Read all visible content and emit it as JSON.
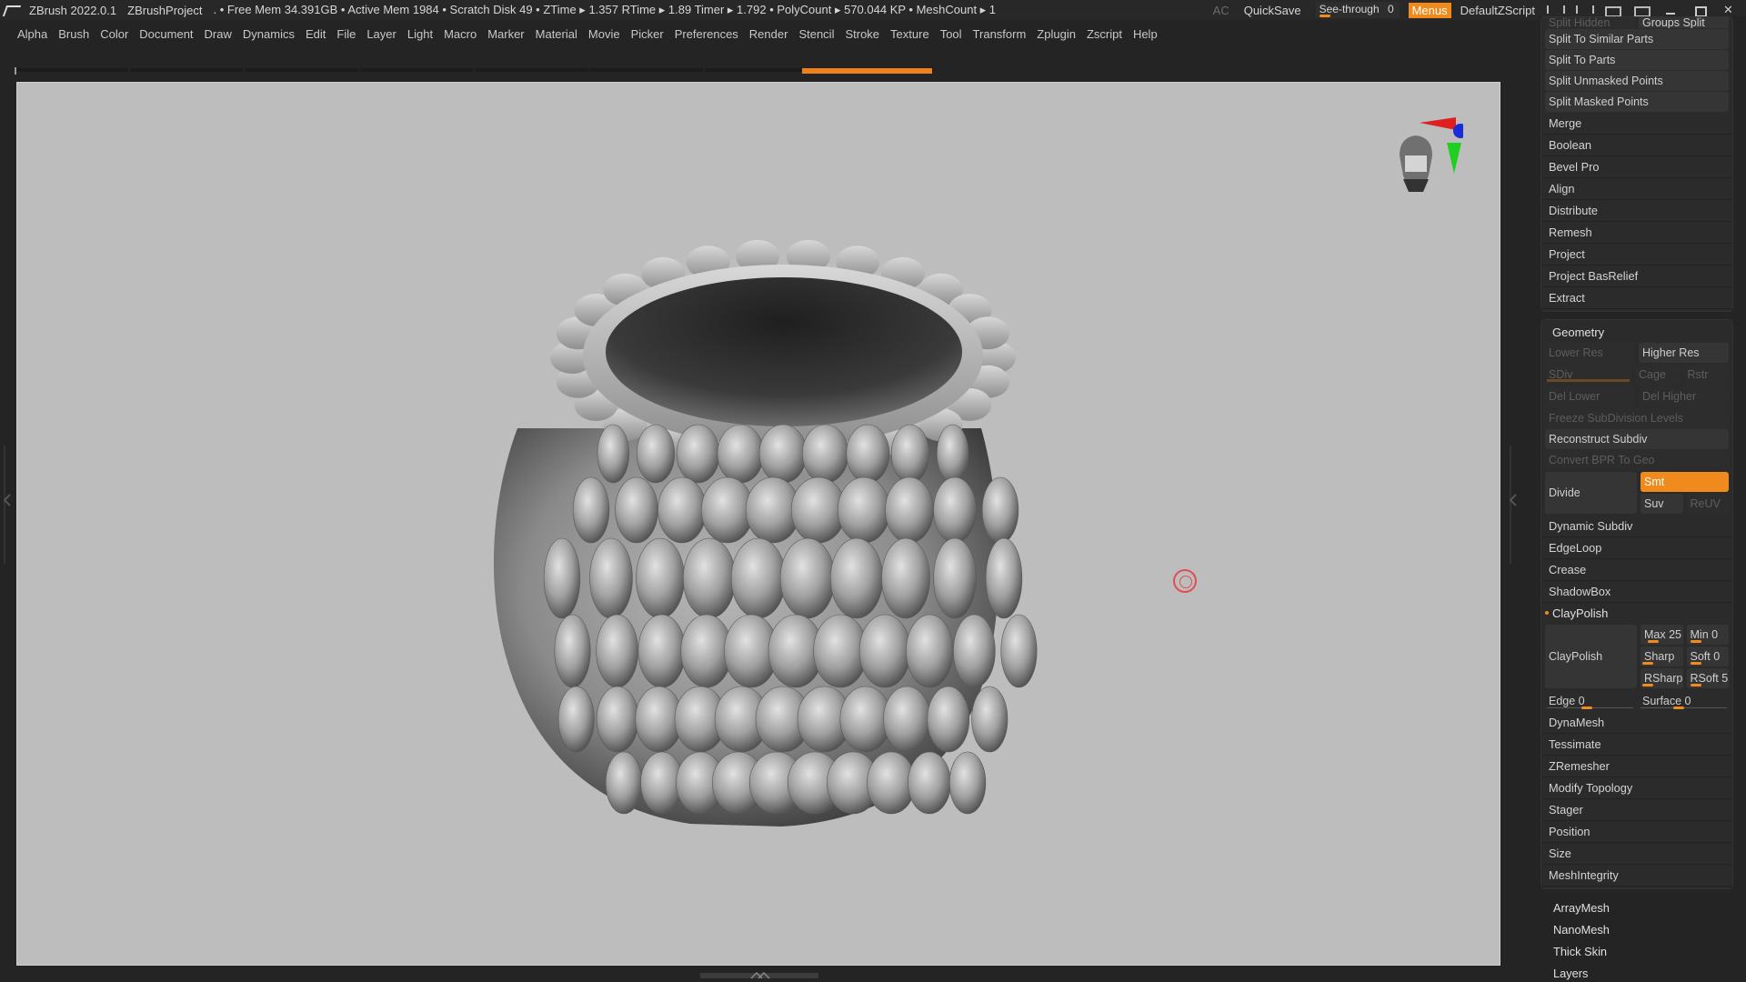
{
  "titlebar": {
    "app": "ZBrush 2022.0.1",
    "project": "ZBrushProject",
    "stats": ". • Free Mem 34.391GB • Active Mem 1984 • Scratch Disk 49 •  ZTime ▸ 1.357 RTime ▸ 1.89 Timer ▸ 1.792 • PolyCount ▸ 570.044 KP  • MeshCount ▸ 1",
    "ac": "AC",
    "quicksave": "QuickSave",
    "seethrough_label": "See-through",
    "seethrough_value": "0",
    "menus": "Menus",
    "script": "DefaultZScript",
    "accent": "#f08a1c"
  },
  "menubar": [
    "Alpha",
    "Brush",
    "Color",
    "Document",
    "Draw",
    "Dynamics",
    "Edit",
    "File",
    "Layer",
    "Light",
    "Macro",
    "Marker",
    "Material",
    "Movie",
    "Picker",
    "Preferences",
    "Render",
    "Stencil",
    "Stroke",
    "Texture",
    "Tool",
    "Transform",
    "Zplugin",
    "Zscript",
    "Help"
  ],
  "panel": {
    "top_half": {
      "left": "Split Hidden",
      "right": "Groups Split"
    },
    "split_buttons": [
      "Split To Similar Parts",
      "Split To Parts",
      "Split Unmasked Points",
      "Split Masked Points"
    ],
    "subtool_items": [
      "Merge",
      "Boolean",
      "Bevel Pro",
      "Align",
      "Distribute",
      "Remesh",
      "Project",
      "Project BasRelief",
      "Extract"
    ],
    "geometry": {
      "title": "Geometry",
      "lower_res": "Lower Res",
      "higher_res": "Higher Res",
      "sdiv": "SDiv",
      "cage": "Cage",
      "rstr": "Rstr",
      "del_lower": "Del Lower",
      "del_higher": "Del Higher",
      "freeze": "Freeze SubDivision Levels",
      "reconstruct": "Reconstruct Subdiv",
      "convert": "Convert BPR To Geo",
      "divide": "Divide",
      "smt": "Smt",
      "suv": "Suv",
      "reuv": "ReUV",
      "items_a": [
        "Dynamic Subdiv",
        "EdgeLoop",
        "Crease",
        "ShadowBox"
      ],
      "claypolish_header": "ClayPolish",
      "claypolish_btn": "ClayPolish",
      "max": "Max 25",
      "min": "Min 0",
      "sharp": "Sharp",
      "soft": "Soft 0",
      "rsharp": "RSharp",
      "rsoft": "RSoft 5",
      "edge": "Edge 0",
      "surface": "Surface 0",
      "items_b": [
        "DynaMesh",
        "Tessimate",
        "ZRemesher",
        "Modify Topology",
        "Stager",
        "Position",
        "Size",
        "MeshIntegrity"
      ]
    },
    "bottom_items": [
      "ArrayMesh",
      "NanoMesh",
      "Thick Skin",
      "Layers"
    ]
  }
}
